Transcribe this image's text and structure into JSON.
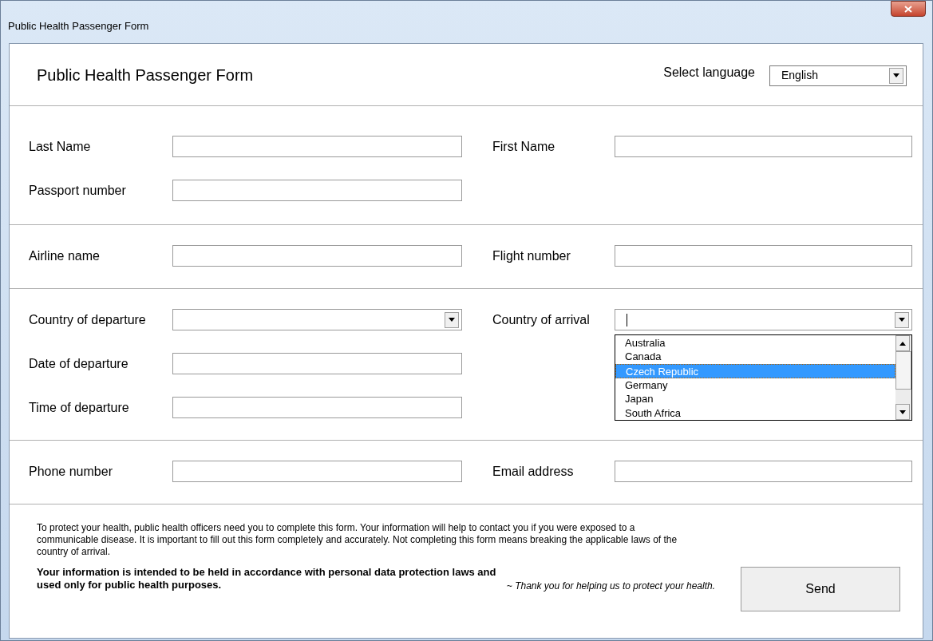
{
  "window": {
    "title": "Public Health Passenger Form"
  },
  "header": {
    "title": "Public Health Passenger Form",
    "language_label": "Select language",
    "language_value": "English"
  },
  "sections": [
    {
      "left": [
        {
          "kind": "text",
          "label": "Last Name"
        },
        {
          "kind": "text",
          "label": "Passport number"
        }
      ],
      "right": [
        {
          "kind": "text",
          "label": "First Name"
        }
      ]
    },
    {
      "left": [
        {
          "kind": "text",
          "label": "Airline name"
        }
      ],
      "right": [
        {
          "kind": "text",
          "label": "Flight number"
        }
      ]
    },
    {
      "left": [
        {
          "kind": "combo",
          "label": "Country of departure"
        },
        {
          "kind": "text",
          "label": "Date of departure"
        },
        {
          "kind": "text",
          "label": "Time of departure"
        }
      ],
      "right": [
        {
          "kind": "combo",
          "label": "Country of arrival",
          "expanded": true,
          "options": [
            {
              "label": "Australia",
              "selected": false
            },
            {
              "label": "Canada",
              "selected": false
            },
            {
              "label": "Czech Republic",
              "selected": true
            },
            {
              "label": "Germany",
              "selected": false
            },
            {
              "label": "Japan",
              "selected": false
            },
            {
              "label": "South Africa",
              "selected": false
            }
          ]
        }
      ]
    },
    {
      "left": [
        {
          "kind": "text",
          "label": "Phone number"
        }
      ],
      "right": [
        {
          "kind": "text",
          "label": "Email address"
        }
      ]
    }
  ],
  "footer": {
    "notice": "To protect your health, public health officers need you to complete this form. Your information will help to contact you if you were exposed to a communicable disease. It is important to fill out this form completely and accurately. Not completing this form means breaking the applicable laws of the country of arrival.",
    "privacy": "Your information is intended to be held in accordance with personal data protection laws and used only for public health purposes.",
    "thanks": "~ Thank you for helping us to protect your health.",
    "send_button": "Send"
  }
}
